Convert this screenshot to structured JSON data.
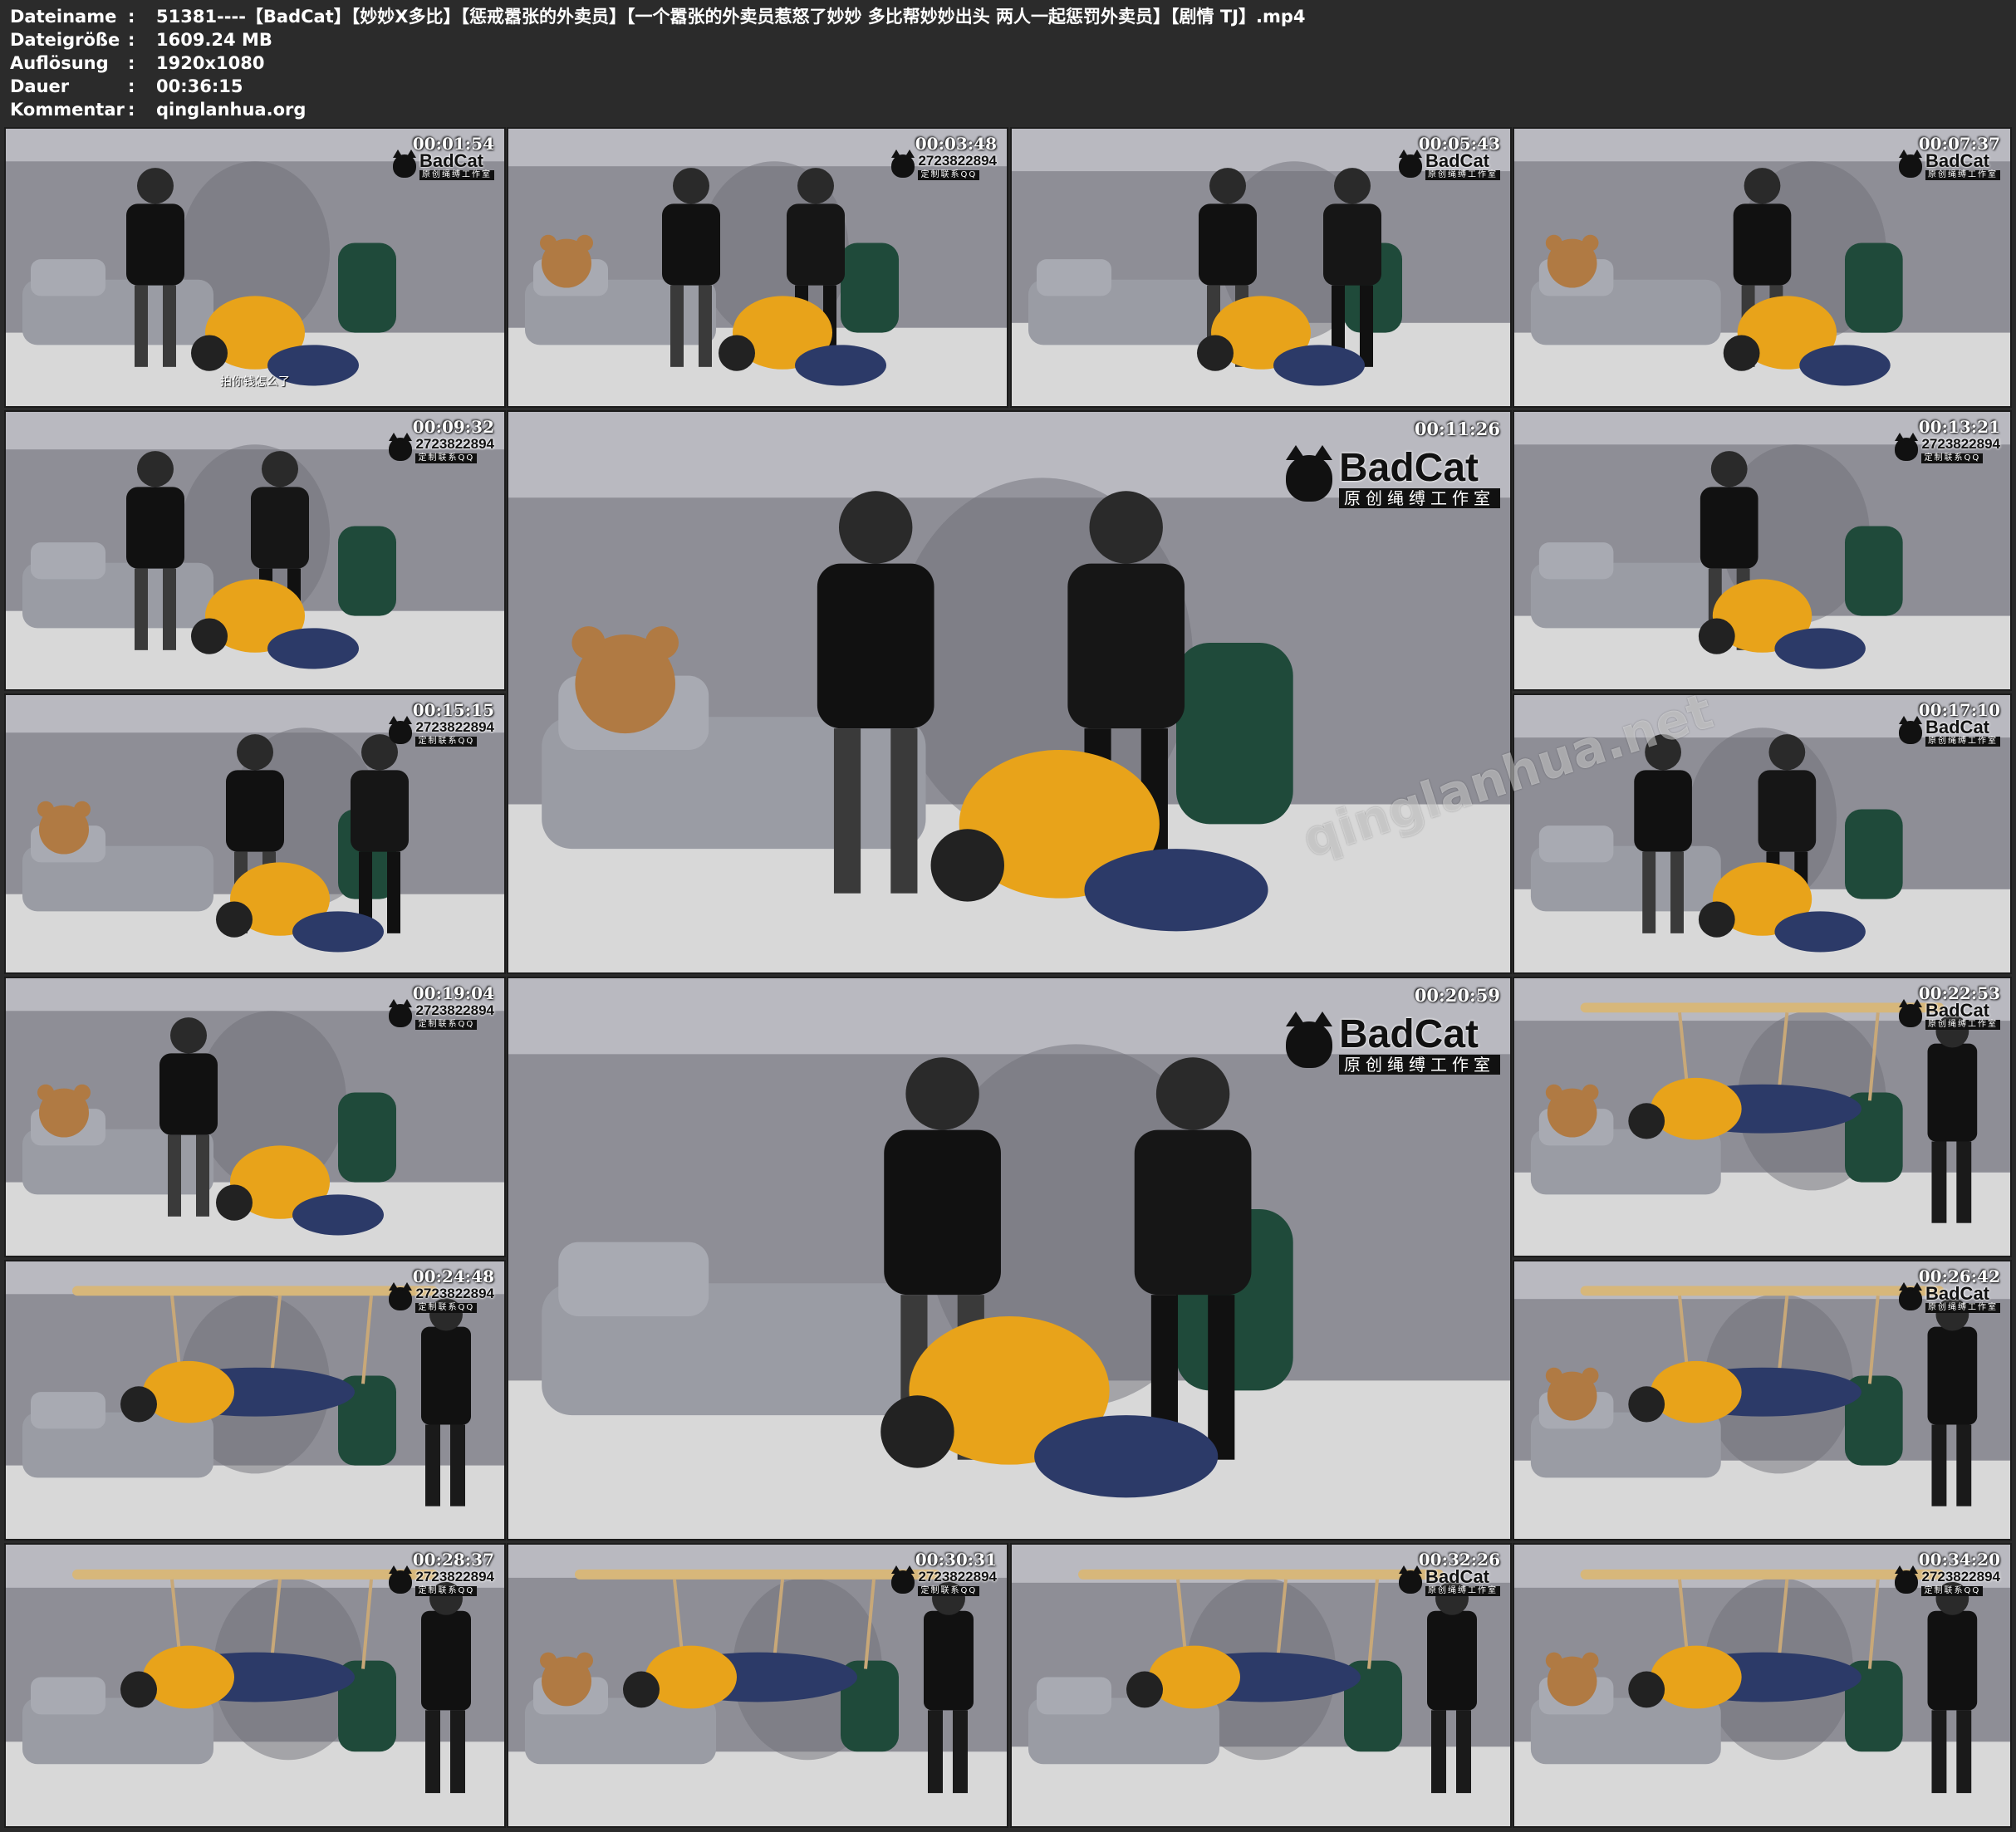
{
  "meta": {
    "rows": [
      {
        "key": "Dateiname",
        "sep": ":",
        "value": "51381----【BadCat】【妙妙X多比】【惩戒嚣张的外卖员】【一个嚣张的外卖员惹怒了妙妙 多比帮妙妙出头 两人一起惩罚外卖员】【剧情 TJ】.mp4"
      },
      {
        "key": "Dateigröße",
        "sep": ":",
        "value": "1609.24 MB"
      },
      {
        "key": "Auflösung",
        "sep": ":",
        "value": "1920x1080"
      },
      {
        "key": "Dauer",
        "sep": ":",
        "value": "00:36:15"
      },
      {
        "key": "Kommentar",
        "sep": ":",
        "value": "qinglanhua.org"
      }
    ]
  },
  "logo": {
    "brand": "BadCat",
    "subtitle": "原创绳缚工作室",
    "alt_number": "2723822894",
    "alt_caption": "定制联系QQ"
  },
  "watermark": "qinglanhua.net",
  "thumbnails": [
    {
      "time": "00:01:54",
      "badge": "BadCat",
      "caption": "拍你钱怎么了"
    },
    {
      "time": "00:03:48",
      "badge": "number"
    },
    {
      "time": "00:05:43",
      "badge": "BadCat"
    },
    {
      "time": "00:07:37",
      "badge": "BadCat"
    },
    {
      "time": "00:09:32",
      "badge": "number"
    },
    {
      "time": "00:11:26",
      "badge": "BadCat"
    },
    {
      "time": "00:13:21",
      "badge": "number"
    },
    {
      "time": "00:15:15",
      "badge": "number"
    },
    {
      "time": "00:17:10",
      "badge": "BadCat"
    },
    {
      "time": "00:19:04",
      "badge": "number"
    },
    {
      "time": "00:20:59",
      "badge": "BadCat"
    },
    {
      "time": "00:22:53",
      "badge": "BadCat"
    },
    {
      "time": "00:24:48",
      "badge": "number"
    },
    {
      "time": "00:26:42",
      "badge": "BadCat"
    },
    {
      "time": "00:28:37",
      "badge": "number"
    },
    {
      "time": "00:30:31",
      "badge": "number"
    },
    {
      "time": "00:32:26",
      "badge": "BadCat"
    },
    {
      "time": "00:34:20",
      "badge": "number"
    }
  ],
  "colors": {
    "background": "#2b2b2b",
    "wall": "#8e8e96",
    "floor": "#d8d8d8",
    "shirt": "#e8a31a",
    "dress": "#111111",
    "sofa": "#9a9ca4",
    "chair": "#1f4a3a",
    "rope": "#c8a878"
  }
}
